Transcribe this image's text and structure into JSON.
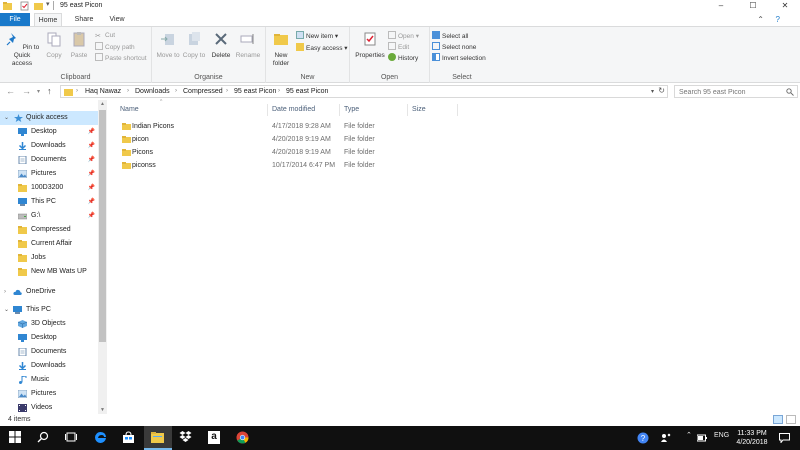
{
  "window": {
    "title": "95 east Picon",
    "controls": {
      "minimize": "–",
      "maximize": "☐",
      "close": "✕"
    }
  },
  "ribbon_tabs": [
    "File",
    "Home",
    "Share",
    "View"
  ],
  "ribbon": {
    "clipboard": {
      "label": "Clipboard",
      "pin": "Pin to Quick access",
      "copy": "Copy",
      "paste": "Paste",
      "cut": "Cut",
      "copy_path": "Copy path",
      "paste_shortcut": "Paste shortcut"
    },
    "organise": {
      "label": "Organise",
      "move_to": "Move to",
      "copy_to": "Copy to",
      "delete": "Delete",
      "rename": "Rename"
    },
    "new": {
      "label": "New",
      "new_folder": "New folder",
      "new_item": "New item",
      "easy_access": "Easy access"
    },
    "open": {
      "label": "Open",
      "properties": "Properties",
      "open": "Open",
      "edit": "Edit",
      "history": "History"
    },
    "select": {
      "label": "Select",
      "select_all": "Select all",
      "select_none": "Select none",
      "invert": "Invert selection"
    }
  },
  "address": {
    "crumbs": [
      "Haq Nawaz",
      "Downloads",
      "Compressed",
      "95 east Picon",
      "95 east Picon"
    ],
    "search_placeholder": "Search 95 east Picon"
  },
  "nav": {
    "quick_access": "Quick access",
    "pinned": [
      "Desktop",
      "Downloads",
      "Documents",
      "Pictures",
      "100D3200",
      "This PC",
      "G:\\"
    ],
    "folders": [
      "Compressed",
      "Current Affair",
      "Jobs",
      "New MB Wats UP"
    ],
    "onedrive": "OneDrive",
    "this_pc": "This PC",
    "pc_items": [
      "3D Objects",
      "Desktop",
      "Documents",
      "Downloads",
      "Music",
      "Pictures",
      "Videos"
    ]
  },
  "columns": {
    "name": "Name",
    "date": "Date modified",
    "type": "Type",
    "size": "Size"
  },
  "files": [
    {
      "name": "Indian Picons",
      "date": "4/17/2018 9:28 AM",
      "type": "File folder"
    },
    {
      "name": "picon",
      "date": "4/20/2018 9:19 AM",
      "type": "File folder"
    },
    {
      "name": "Picons",
      "date": "4/20/2018 9:19 AM",
      "type": "File folder"
    },
    {
      "name": "piconss",
      "date": "10/17/2014 6:47 PM",
      "type": "File folder"
    }
  ],
  "status": {
    "count": "4 items"
  },
  "taskbar": {
    "language": "ENG",
    "time": "11:33 PM",
    "date": "4/20/2018",
    "amazon_glyph": "a"
  },
  "colors": {
    "accent": "#1979ca",
    "folder": "#f0c94a",
    "selection": "#cce8ff",
    "taskbar": "#101010"
  }
}
